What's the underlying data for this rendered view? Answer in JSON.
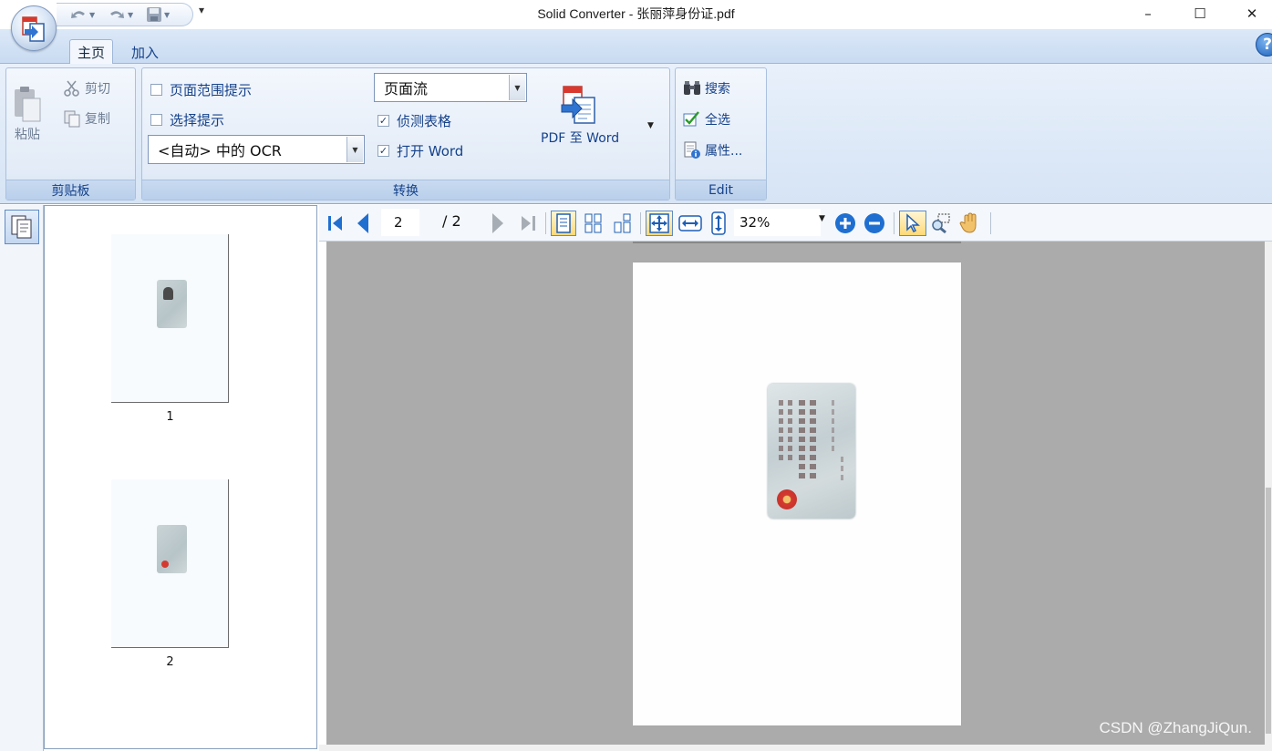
{
  "window": {
    "title": "Solid Converter - 张丽萍身份证.pdf",
    "minimize": "–",
    "maximize": "☐",
    "close": "✕",
    "qat_more": "▾"
  },
  "tabs": [
    {
      "label": "主页",
      "active": true
    },
    {
      "label": "加入",
      "active": false
    }
  ],
  "help_label": "?",
  "clipboard": {
    "paste": "粘贴",
    "cut": "剪切",
    "copy": "复制",
    "group_label": "剪贴板"
  },
  "convert": {
    "page_range_hint": "页面范围提示",
    "selection_hint": "选择提示",
    "ocr_select": "<自动> 中的 OCR",
    "layout_select": "页面流",
    "detect_tables": "侦测表格",
    "open_word": "打开 Word",
    "pdf_to_word": "PDF 至 Word",
    "group_label": "转换",
    "checks": {
      "page_range_hint": false,
      "selection_hint": false,
      "detect_tables": true,
      "open_word": true
    }
  },
  "edit": {
    "search": "搜索",
    "select_all": "全选",
    "properties": "属性...",
    "group_label": "Edit"
  },
  "thumbnails": [
    {
      "number": "1"
    },
    {
      "number": "2"
    }
  ],
  "viewer": {
    "current_page": "2",
    "total_pages": "/ 2",
    "zoom": "32%"
  },
  "watermark": "CSDN @ZhangJiQun.",
  "colors": {
    "ribbon_text": "#15428b",
    "doc_background": "#ababab",
    "accent_blue": "#1a5fb9"
  }
}
